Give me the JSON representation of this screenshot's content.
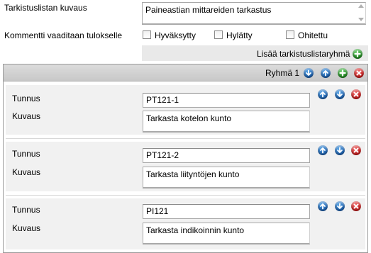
{
  "form": {
    "desc_label": "Tarkistuslistan kuvaus",
    "desc_value": "Paineastian mittareiden tarkastus",
    "comment_label": "Kommentti vaaditaan tulokselle",
    "options": [
      {
        "label": "Hyväksytty",
        "checked": false
      },
      {
        "label": "Hylätty",
        "checked": false
      },
      {
        "label": "Ohitettu",
        "checked": false
      }
    ],
    "add_group_label": "Lisää tarkistuslistaryhmä"
  },
  "group": {
    "title": "Ryhmä 1",
    "items": [
      {
        "id_label": "Tunnus",
        "id_value": "PT121-1",
        "desc_label": "Kuvaus",
        "desc_value": "Tarkasta kotelon kunto"
      },
      {
        "id_label": "Tunnus",
        "id_value": "PT121-2",
        "desc_label": "Kuvaus",
        "desc_value": "Tarkasta liityntöjen kunto"
      },
      {
        "id_label": "Tunnus",
        "id_value": "PI121",
        "desc_label": "Kuvaus",
        "desc_value": "Tarkasta indikoinnin kunto"
      }
    ]
  },
  "colors": {
    "icon_blue": "#1a5fb0",
    "icon_green": "#1f8a1f",
    "icon_red": "#c81818"
  },
  "icons": [
    "arrow-down-icon",
    "arrow-up-icon",
    "plus-icon",
    "delete-icon"
  ]
}
